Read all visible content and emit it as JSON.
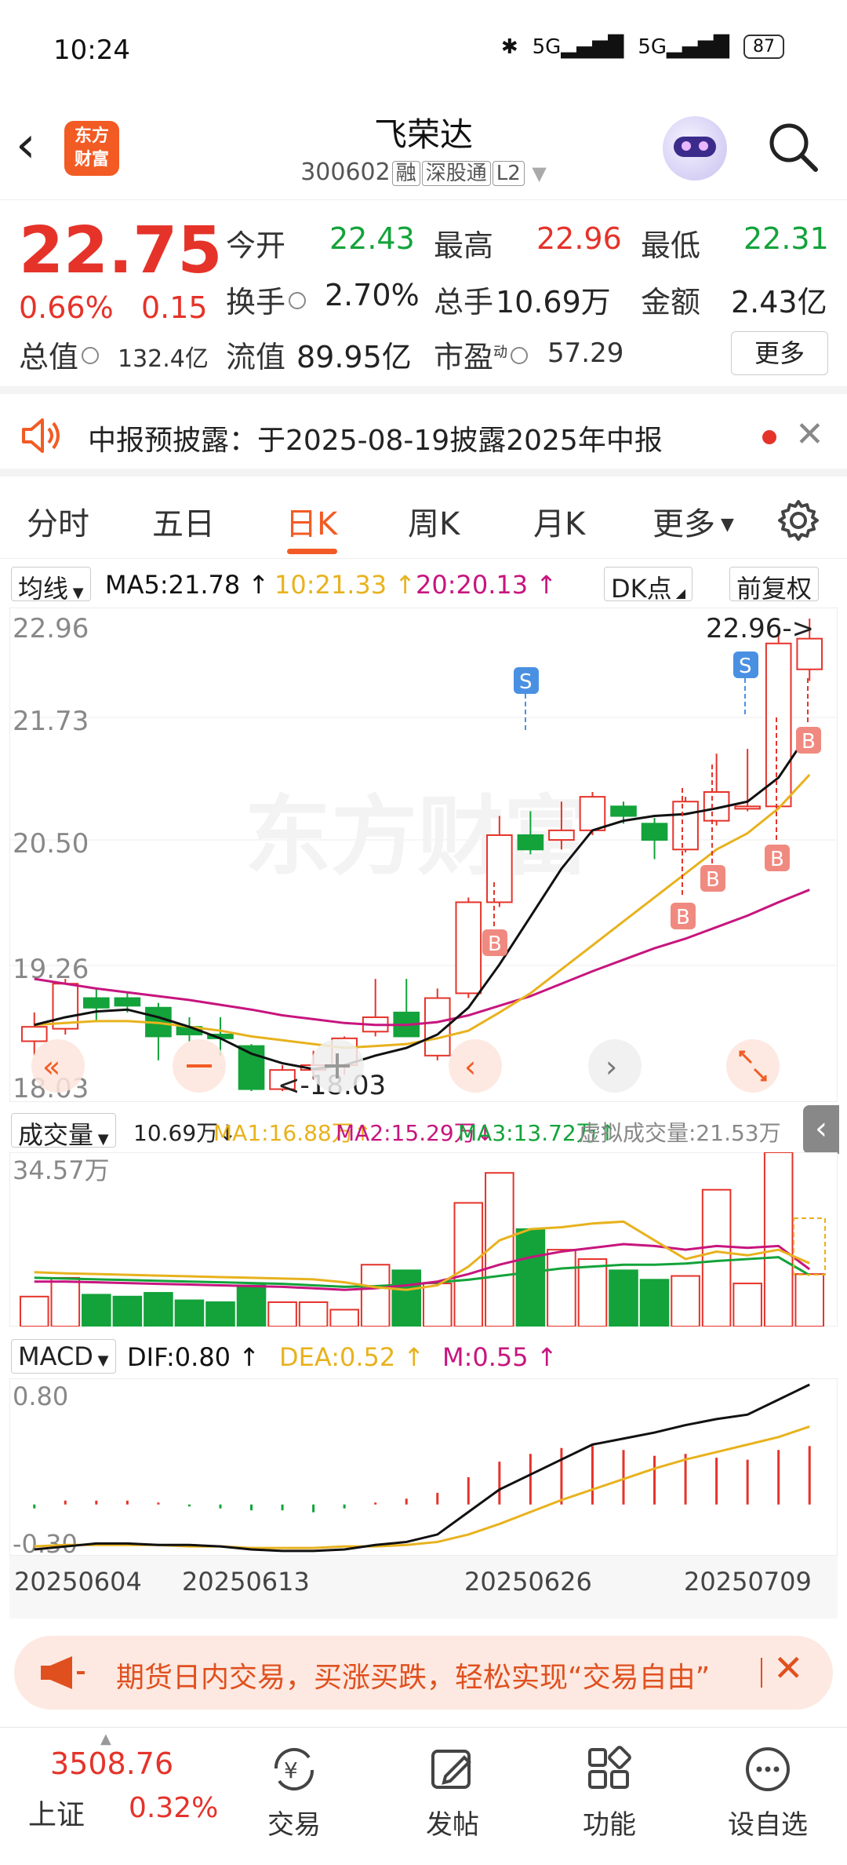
{
  "status_bar": {
    "time": "10:24",
    "signal": "5G",
    "signal2": "5G",
    "battery": "87"
  },
  "header": {
    "logo_line1": "东方",
    "logo_line2": "财富",
    "stock_name": "飞荣达",
    "stock_code": "300602",
    "tags": [
      "融",
      "深股通",
      "L2"
    ]
  },
  "quote": {
    "price": "22.75",
    "change_pct": "0.66%",
    "change": "0.15",
    "open_label": "今开",
    "open": "22.43",
    "high_label": "最高",
    "high": "22.96",
    "low_label": "最低",
    "low": "22.31",
    "turnover_label": "换手",
    "turnover": "2.70%",
    "volume_label": "总手",
    "volume": "10.69万",
    "amount_label": "金额",
    "amount": "2.43亿",
    "mktcap_label": "总值",
    "mktcap": "132.4亿",
    "float_label": "流值",
    "float": "89.95亿",
    "pe_label": "市盈",
    "pe_sup": "动",
    "pe": "57.29",
    "more": "更多"
  },
  "notice": {
    "text": "中报预披露：于2025-08-19披露2025年中报"
  },
  "tabs": [
    "分时",
    "五日",
    "日K",
    "周K",
    "月K",
    "更多"
  ],
  "active_tab": "日K",
  "ma_bar": {
    "selector": "均线",
    "ma5": "MA5:21.78",
    "ma10": "10:21.33",
    "ma20": "20:20.13",
    "dk": "DK点",
    "adjust": "前复权"
  },
  "kline": {
    "y_ticks": [
      "22.96",
      "21.73",
      "20.50",
      "19.26",
      "18.03"
    ],
    "high_marker": "22.96->",
    "low_marker": "<-18.03",
    "watermark": "东方财富",
    "signal_s": "S",
    "signal_b": "B"
  },
  "volume_bar": {
    "selector": "成交量",
    "vol": "10.69万",
    "ma1": "MA1:16.88万",
    "ma2": "MA2:15.29万",
    "ma3": "MA3:13.72万",
    "virtual": "虚拟成交量:21.53万",
    "max": "34.57万"
  },
  "macd_bar": {
    "selector": "MACD",
    "dif": "DIF:0.80",
    "dea": "DEA:0.52",
    "m": "M:0.55",
    "top": "0.80",
    "bottom": "-0.30"
  },
  "dates": [
    "20250604",
    "20250613",
    "20250626",
    "20250709"
  ],
  "ad": {
    "text": "期货日内交易，买涨买跌，轻松实现“交易自由”"
  },
  "nav": {
    "index_value": "3508.76",
    "index_name": "上证",
    "index_change": "0.32%",
    "items": [
      "交易",
      "发帖",
      "功能",
      "设自选"
    ]
  },
  "colors": {
    "up": "#e5332a",
    "down": "#13a33a",
    "accent": "#f25b24",
    "ma5": "#111111",
    "ma10": "#e8b21e",
    "ma20": "#c7157e"
  },
  "chart_data": {
    "type": "candlestick",
    "ylim": [
      18.03,
      22.96
    ],
    "candles": [
      {
        "o": 18.55,
        "c": 18.7,
        "h": 18.85,
        "l": 18.4
      },
      {
        "o": 18.68,
        "c": 19.15,
        "h": 19.2,
        "l": 18.62
      },
      {
        "o": 19.0,
        "c": 18.9,
        "h": 19.1,
        "l": 18.75
      },
      {
        "o": 19.0,
        "c": 18.92,
        "h": 19.05,
        "l": 18.85
      },
      {
        "o": 18.9,
        "c": 18.6,
        "h": 18.95,
        "l": 18.35
      },
      {
        "o": 18.7,
        "c": 18.62,
        "h": 18.8,
        "l": 18.55
      },
      {
        "o": 18.62,
        "c": 18.58,
        "h": 18.8,
        "l": 18.4
      },
      {
        "o": 18.5,
        "c": 18.05,
        "h": 18.52,
        "l": 18.03
      },
      {
        "o": 18.05,
        "c": 18.25,
        "h": 18.3,
        "l": 18.03
      },
      {
        "o": 18.25,
        "c": 18.3,
        "h": 18.45,
        "l": 18.15
      },
      {
        "o": 18.3,
        "c": 18.58,
        "h": 18.6,
        "l": 18.2
      },
      {
        "o": 18.65,
        "c": 18.8,
        "h": 19.2,
        "l": 18.6
      },
      {
        "o": 18.85,
        "c": 18.6,
        "h": 19.2,
        "l": 18.6
      },
      {
        "o": 18.4,
        "c": 19.0,
        "h": 19.1,
        "l": 18.35
      },
      {
        "o": 19.05,
        "c": 20.0,
        "h": 20.05,
        "l": 19.0
      },
      {
        "o": 20.0,
        "c": 20.7,
        "h": 20.9,
        "l": 19.95
      },
      {
        "o": 20.7,
        "c": 20.55,
        "h": 20.95,
        "l": 20.5
      },
      {
        "o": 20.65,
        "c": 20.75,
        "h": 21.05,
        "l": 20.55
      },
      {
        "o": 20.75,
        "c": 21.1,
        "h": 21.15,
        "l": 20.7
      },
      {
        "o": 21.0,
        "c": 20.9,
        "h": 21.05,
        "l": 20.82
      },
      {
        "o": 20.82,
        "c": 20.65,
        "h": 20.88,
        "l": 20.45
      },
      {
        "o": 20.55,
        "c": 21.05,
        "h": 21.1,
        "l": 20.52
      },
      {
        "o": 20.85,
        "c": 21.15,
        "h": 21.55,
        "l": 20.8
      },
      {
        "o": 21.0,
        "c": 21.0,
        "h": 21.6,
        "l": 20.95
      },
      {
        "o": 21.0,
        "c": 22.7,
        "h": 22.85,
        "l": 21.0
      },
      {
        "o": 22.43,
        "c": 22.75,
        "h": 22.96,
        "l": 22.31
      }
    ],
    "ma5": [
      18.72,
      18.8,
      18.86,
      18.88,
      18.8,
      18.7,
      18.58,
      18.42,
      18.32,
      18.26,
      18.3,
      18.4,
      18.48,
      18.62,
      18.9,
      19.35,
      19.85,
      20.35,
      20.75,
      20.85,
      20.9,
      20.92,
      20.98,
      21.05,
      21.3,
      21.78
    ],
    "ma10": [
      18.72,
      18.74,
      18.76,
      18.76,
      18.74,
      18.7,
      18.66,
      18.6,
      18.56,
      18.52,
      18.48,
      18.5,
      18.52,
      18.58,
      18.66,
      18.85,
      19.05,
      19.3,
      19.55,
      19.8,
      20.05,
      20.3,
      20.55,
      20.72,
      20.98,
      21.33
    ],
    "ma20": [
      19.2,
      19.15,
      19.1,
      19.06,
      19.02,
      18.98,
      18.93,
      18.88,
      18.82,
      18.78,
      18.74,
      18.72,
      18.72,
      18.75,
      18.82,
      18.92,
      19.02,
      19.15,
      19.28,
      19.4,
      19.52,
      19.62,
      19.74,
      19.86,
      20.0,
      20.13
    ],
    "volume": [
      8.0,
      13.0,
      8.5,
      8.0,
      9.0,
      7.0,
      6.5,
      11.0,
      6.5,
      6.5,
      4.5,
      16.5,
      15.0,
      11.5,
      33.0,
      41.0,
      26.0,
      20.5,
      18.0,
      15.0,
      12.5,
      13.5,
      36.5,
      11.5,
      46.5,
      14.0
    ],
    "vol_ma1": [
      14.5,
      14.2,
      14.0,
      13.8,
      13.6,
      13.4,
      13.2,
      13.0,
      12.8,
      12.6,
      11.8,
      10.5,
      9.8,
      11.0,
      16.0,
      23.0,
      26.0,
      26.5,
      27.5,
      28.0,
      23.0,
      18.0,
      20.0,
      19.0,
      20.5,
      16.88
    ],
    "vol_ma2": [
      12.0,
      12.0,
      11.8,
      11.6,
      11.4,
      11.2,
      11.0,
      10.8,
      10.6,
      10.2,
      9.8,
      10.2,
      11.0,
      12.0,
      14.0,
      16.5,
      18.5,
      20.0,
      21.0,
      22.0,
      21.5,
      20.5,
      21.5,
      21.0,
      21.5,
      15.29
    ],
    "vol_ma3": [
      13.0,
      12.8,
      12.6,
      12.4,
      12.2,
      12.0,
      11.8,
      11.6,
      11.4,
      11.0,
      10.6,
      10.8,
      11.2,
      11.8,
      12.5,
      13.5,
      14.5,
      15.5,
      16.0,
      16.5,
      16.5,
      16.8,
      17.5,
      18.0,
      18.5,
      13.72
    ],
    "vol_ylim": [
      0,
      46.5
    ],
    "macd_hist": [
      -0.02,
      0.02,
      0.02,
      0.02,
      0.01,
      -0.01,
      -0.02,
      -0.03,
      -0.03,
      -0.04,
      -0.02,
      0.01,
      0.03,
      0.06,
      0.14,
      0.22,
      0.26,
      0.29,
      0.3,
      0.28,
      0.25,
      0.26,
      0.24,
      0.23,
      0.28,
      0.3
    ],
    "dif": [
      -0.3,
      -0.28,
      -0.26,
      -0.26,
      -0.27,
      -0.27,
      -0.28,
      -0.3,
      -0.31,
      -0.31,
      -0.3,
      -0.27,
      -0.25,
      -0.2,
      -0.05,
      0.1,
      0.2,
      0.3,
      0.4,
      0.44,
      0.48,
      0.53,
      0.57,
      0.6,
      0.7,
      0.8
    ],
    "dea": [
      -0.28,
      -0.27,
      -0.27,
      -0.27,
      -0.27,
      -0.28,
      -0.28,
      -0.29,
      -0.29,
      -0.29,
      -0.28,
      -0.28,
      -0.27,
      -0.25,
      -0.2,
      -0.13,
      -0.05,
      0.03,
      0.1,
      0.17,
      0.24,
      0.3,
      0.35,
      0.4,
      0.45,
      0.52
    ],
    "macd_ylim": [
      -0.3,
      0.8
    ]
  }
}
